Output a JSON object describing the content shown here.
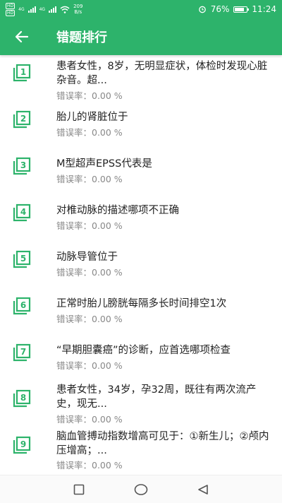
{
  "status_bar": {
    "sim1": "HD",
    "sim2": "HD",
    "net1": "4G",
    "net2": "4G",
    "speed_value": "209",
    "speed_unit": "B/s",
    "battery": "76%",
    "time": "11:24",
    "icons": [
      "alarm-icon",
      "battery-icon",
      "wifi-icon",
      "signal-icon"
    ]
  },
  "toolbar": {
    "title": "错题排行",
    "back_icon": "arrow-left-icon"
  },
  "items": [
    {
      "num": "1",
      "question": "患者女性，8岁，无明显症状，体检时发现心脏杂音。超...",
      "rate": "错误率：0.00 %"
    },
    {
      "num": "2",
      "question": "胎儿的肾脏位于",
      "rate": "错误率：0.00 %"
    },
    {
      "num": "3",
      "question": "M型超声EPSS代表是",
      "rate": "错误率：0.00 %"
    },
    {
      "num": "4",
      "question": "对椎动脉的描述哪项不正确",
      "rate": "错误率：0.00 %"
    },
    {
      "num": "5",
      "question": "动脉导管位于",
      "rate": "错误率：0.00 %"
    },
    {
      "num": "6",
      "question": "正常时胎儿膀胱每隔多长时间排空1次",
      "rate": "错误率：0.00 %"
    },
    {
      "num": "7",
      "question": "“早期胆囊癌”的诊断，应首选哪项检查",
      "rate": "错误率：0.00 %"
    },
    {
      "num": "8",
      "question": "患者女性，34岁，孕32周，既往有两次流产史，现无...",
      "rate": "错误率：0.00 %"
    },
    {
      "num": "9",
      "question": "脑血管搏动指数增高可见于：①新生儿；②颅内压增高；...",
      "rate": "错误率：0.00 %"
    }
  ],
  "colors": {
    "accent": "#2db36b",
    "text": "#222222",
    "subtext": "#888888"
  },
  "nav": {
    "icons": [
      "recent-apps-icon",
      "home-icon",
      "back-triangle-icon"
    ]
  }
}
